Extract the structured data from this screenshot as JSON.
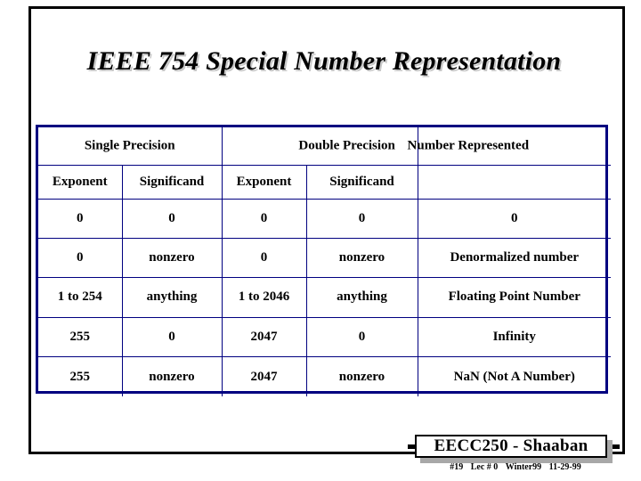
{
  "slide": {
    "title": "IEEE 754  Special Number Representation",
    "frame_color": "#000000",
    "background_color": "#ffffff"
  },
  "table": {
    "border_color": "#000080",
    "group_headers": [
      {
        "label": "Single Precision",
        "colspan": 2
      },
      {
        "label": "Double Precision",
        "colspan": 2
      },
      {
        "label": "Number Represented",
        "colspan": 1
      }
    ],
    "sub_headers": [
      "Exponent",
      "Significand",
      "Exponent",
      "Significand",
      ""
    ],
    "rows": [
      {
        "single_exponent": "0",
        "single_significand": "0",
        "double_exponent": "0",
        "double_significand": "0",
        "number_represented": "0"
      },
      {
        "single_exponent": "0",
        "single_significand": "nonzero",
        "double_exponent": "0",
        "double_significand": "nonzero",
        "number_represented": "Denormalized number"
      },
      {
        "single_exponent": "1 to 254",
        "single_significand": "anything",
        "double_exponent": "1 to 2046",
        "double_significand": "anything",
        "number_represented": "Floating Point Number"
      },
      {
        "single_exponent": "255",
        "single_significand": "0",
        "double_exponent": "2047",
        "double_significand": "0",
        "number_represented": "Infinity"
      },
      {
        "single_exponent": "255",
        "single_significand": "nonzero",
        "double_exponent": "2047",
        "double_significand": "nonzero",
        "number_represented": "NaN (Not A Number)"
      }
    ]
  },
  "footer": {
    "plaque_label": "EECC250 - Shaaban",
    "slide_number": "#19",
    "lecture": "Lec # 0",
    "term": "Winter99",
    "date": "11-29-99"
  }
}
